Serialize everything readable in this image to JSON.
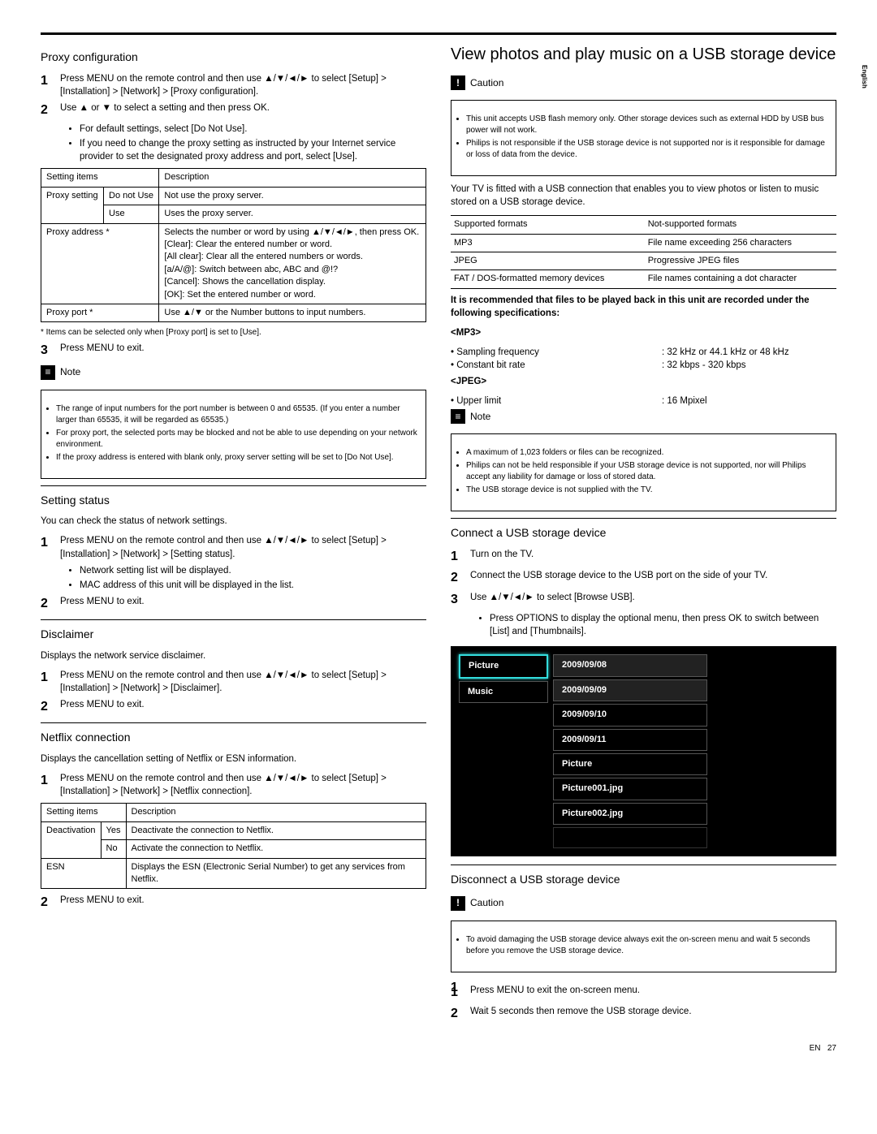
{
  "lang": "English",
  "left": {
    "proxy": {
      "title": "Proxy configuration",
      "step1": "Press MENU on the remote control and then use ▲/▼/◄/► to select [Setup] > [Installation] > [Network] > [Proxy configuration].",
      "step2": "Use ▲ or ▼ to select a setting and then press OK.",
      "b1": "For default settings, select [Do Not Use].",
      "b2": "If you need to change the proxy setting as instructed by your Internet service provider to set the designated proxy address and port, select [Use].",
      "th1": "Setting items",
      "th2": "Description",
      "r1a": "Proxy setting",
      "r1b": "Do not Use",
      "r1c": "Not use the proxy server.",
      "r2b": "Use",
      "r2c": "Uses the proxy server.",
      "r3a": "Proxy address *",
      "r3c": "Selects the number or word by using ▲/▼/◄/►, then press OK.\n[Clear]: Clear the entered number or word.\n[All clear]: Clear all the entered numbers or words.\n[a/A/@]: Switch between abc, ABC and @!?\n[Cancel]: Shows the cancellation display.\n[OK]: Set the entered number or word.",
      "r4a": "Proxy port *",
      "r4c": "Use ▲/▼ or the Number buttons to input numbers.",
      "foot": "* Items can be selected only when [Proxy port] is set to [Use].",
      "step3": "Press MENU to exit.",
      "noteTitle": "Note",
      "n1": "The range of input numbers for the port number is between 0 and 65535. (If you enter a number larger than 65535, it will be regarded as 65535.)",
      "n2": "For proxy port, the selected ports may be blocked and not be able to use depending on your network environment.",
      "n3": "If the proxy address is entered with blank only, proxy server setting will be set to [Do Not Use]."
    },
    "status": {
      "title": "Setting status",
      "intro": "You can check the status of network settings.",
      "step1": "Press MENU on the remote control and then use ▲/▼/◄/► to select [Setup] > [Installation] > [Network] > [Setting status].",
      "b1": "Network setting list will be displayed.",
      "b2": "MAC address of this unit will be displayed in the list.",
      "step2": "Press MENU to exit."
    },
    "disclaimer": {
      "title": "Disclaimer",
      "intro": "Displays the network service disclaimer.",
      "step1": "Press MENU on the remote control and then use ▲/▼/◄/► to select [Setup] > [Installation] > [Network] > [Disclaimer].",
      "step2": "Press MENU to exit."
    },
    "netflix": {
      "title": "Netflix connection",
      "intro": "Displays the cancellation setting of Netflix or ESN information.",
      "step1": "Press MENU on the remote control and then use ▲/▼/◄/► to select [Setup] > [Installation] > [Network] > [Netflix connection].",
      "th1": "Setting items",
      "th2": "Description",
      "r1a": "Deactivation",
      "r1b": "Yes",
      "r1c": "Deactivate the connection to Netflix.",
      "r2b": "No",
      "r2c": "Activate the connection to Netflix.",
      "r3a": "ESN",
      "r3c": "Displays the ESN (Electronic Serial Number) to get any services from Netflix.",
      "step2": "Press MENU to exit."
    }
  },
  "right": {
    "usb": {
      "title": "View photos and play music on a USB storage device",
      "cautionTitle": "Caution",
      "c1": "This unit accepts USB flash memory only. Other storage devices such as external HDD by USB bus power will not work.",
      "c2": "Philips is not responsible if the USB storage device is not supported nor is it responsible for damage or loss of data from the device.",
      "intro": "Your TV is fitted with a USB connection that enables you to view photos or listen to music stored on a USB storage device.",
      "fh1": "Supported formats",
      "fh2": "Not-supported formats",
      "f1a": "MP3",
      "f1b": "File name exceeding 256 characters",
      "f2a": "JPEG",
      "f2b": "Progressive JPEG files",
      "f3a": "FAT / DOS-formatted memory devices",
      "f3b": "File names containing a dot character",
      "rec": "It is recommended that files to be played back in this unit are recorded under the following specifications:",
      "mp3h": "<MP3>",
      "mp3_s1l": "Sampling frequency",
      "mp3_s1v": ": 32 kHz or 44.1 kHz or 48 kHz",
      "mp3_s2l": "Constant bit rate",
      "mp3_s2v": ": 32 kbps - 320 kbps",
      "jpegh": "<JPEG>",
      "jpeg_s1l": "Upper limit",
      "jpeg_s1v": ": 16 Mpixel",
      "noteTitle": "Note",
      "n1": "A maximum of 1,023 folders or files can be recognized.",
      "n2": "Philips can not be held responsible if your USB storage device is not supported, nor will Philips accept any liability for damage or loss of stored data.",
      "n3": "The USB storage device is not supplied with the TV."
    },
    "connect": {
      "title": "Connect a USB storage device",
      "step1": "Turn on the TV.",
      "step2": "Connect the USB storage device to the USB port on the side of your TV.",
      "step3": "Use ▲/▼/◄/► to select [Browse USB].",
      "b1": "Press OPTIONS to display the optional menu, then press OK to switch between [List] and [Thumbnails].",
      "tv": {
        "left1": "Picture",
        "left2": "Music",
        "r1": "2009/09/08",
        "r2": "2009/09/09",
        "r3": "2009/09/10",
        "r4": "2009/09/11",
        "r5": "Picture",
        "r6": "Picture001.jpg",
        "r7": "Picture002.jpg"
      }
    },
    "disconnect": {
      "title": "Disconnect a USB storage device",
      "cautionTitle": "Caution",
      "c1": "To avoid damaging the USB storage device always exit the on-screen menu and wait 5 seconds before you remove the USB storage device.",
      "step1": "Press MENU to exit the on-screen menu.",
      "step2": "Wait 5 seconds then remove the USB storage device."
    }
  },
  "footer": {
    "lang": "EN",
    "page": "27"
  }
}
